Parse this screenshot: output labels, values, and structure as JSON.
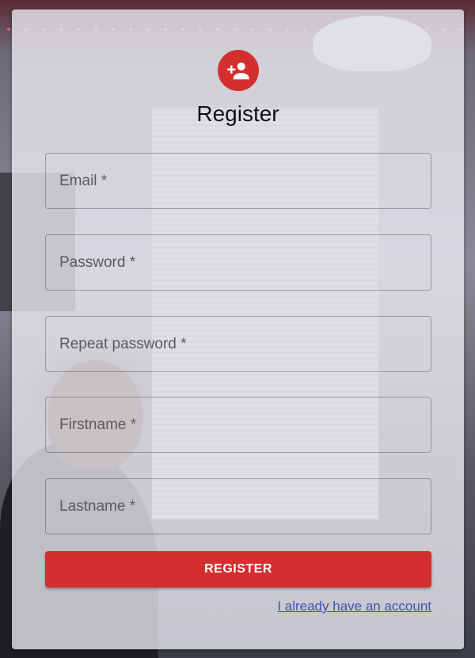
{
  "form": {
    "title": "Register",
    "icon": "person-add-icon",
    "accent_color": "#d32f2f",
    "fields": [
      {
        "placeholder": "Email *"
      },
      {
        "placeholder": "Password *"
      },
      {
        "placeholder": "Repeat password *"
      },
      {
        "placeholder": "Firstname *"
      },
      {
        "placeholder": "Lastname *"
      }
    ],
    "submit_label": "REGISTER",
    "login_link": "I already have an account"
  }
}
